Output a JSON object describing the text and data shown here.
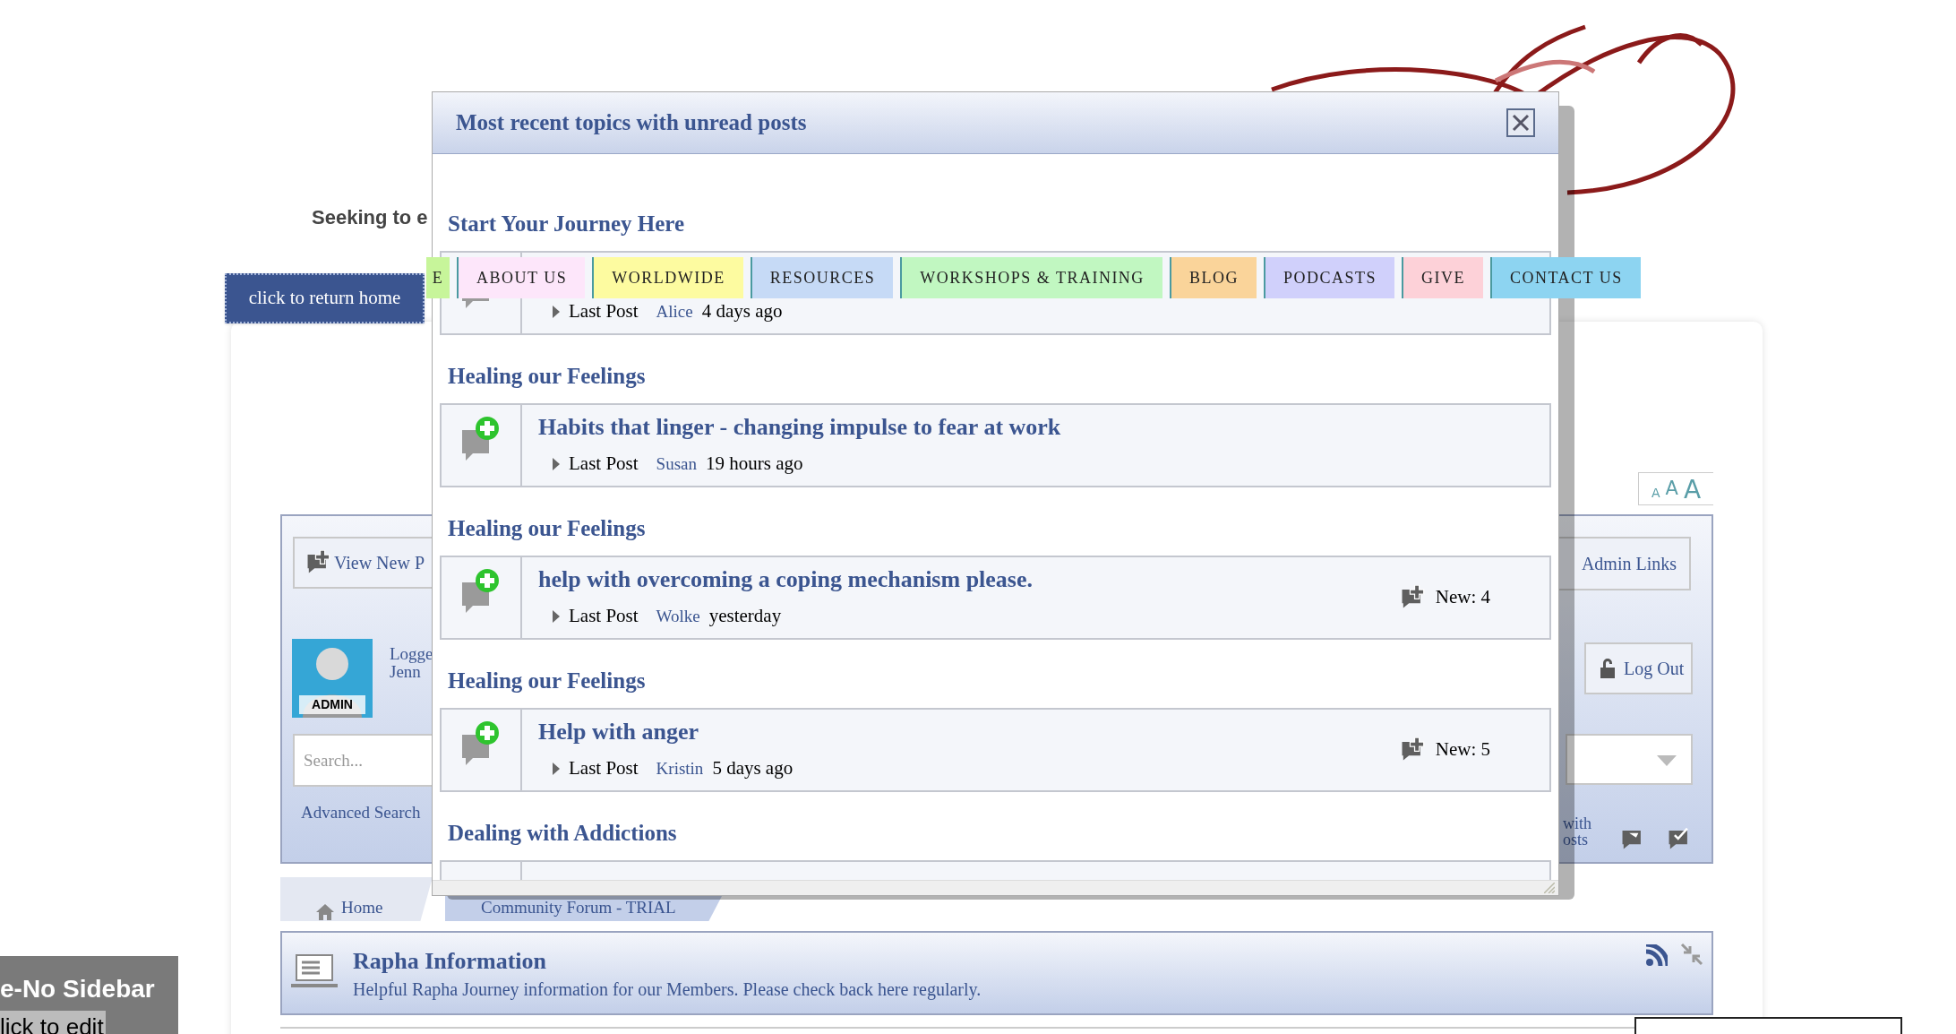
{
  "tagline_fragment": "Seeking to e",
  "return_home_button": "click to return home",
  "nav": [
    {
      "label": "E",
      "color": "#c7f59a"
    },
    {
      "label": "ABOUT US",
      "color": "#fde6fa"
    },
    {
      "label": "WORLDWIDE",
      "color": "#fdfba0"
    },
    {
      "label": "RESOURCES",
      "color": "#c6daf6"
    },
    {
      "label": "WORKSHOPS & TRAINING",
      "color": "#c1f7c1"
    },
    {
      "label": "BLOG",
      "color": "#fad49a"
    },
    {
      "label": "PODCASTS",
      "color": "#d0d0fb"
    },
    {
      "label": "GIVE",
      "color": "#fdd1d8"
    },
    {
      "label": "CONTACT US",
      "color": "#8dd4f1"
    }
  ],
  "font_size_control": [
    "A",
    "A",
    "A"
  ],
  "user_panel": {
    "view_new_posts": "View New P",
    "admin_links": "Admin Links",
    "logged_in": "Logge",
    "user": "Jenn",
    "avatar_badge": "ADMIN",
    "log_out": "Log Out",
    "search": {
      "placeholder": "Search..."
    },
    "advanced_search": "Advanced Search",
    "unread_fragment": "with\nosts"
  },
  "breadcrumbs": [
    {
      "label": "Home",
      "selected": false
    },
    {
      "label": "Community Forum - TRIAL",
      "selected": true
    }
  ],
  "board": {
    "title": "Rapha Information",
    "description": "Helpful Rapha Journey information for our Members. Please check back here regularly."
  },
  "edit_box": {
    "title": "e-No Sidebar",
    "link": "lick to edit"
  },
  "modal": {
    "title": "Most recent topics with unread posts",
    "sections": [
      {
        "heading": "Start Your Journey Here",
        "topic": {
          "last_post_label": "Last Post",
          "author": "Alice",
          "time": "4 days ago"
        }
      },
      {
        "heading": "Healing our Feelings",
        "topic": {
          "title": "Habits that linger - changing impulse to fear at work",
          "last_post_label": "Last Post",
          "author": "Susan",
          "time": "19 hours ago"
        }
      },
      {
        "heading": "Healing our Feelings",
        "topic": {
          "title": "help with overcoming a coping mechanism please.",
          "last_post_label": "Last Post",
          "author": "Wolke",
          "time": "yesterday",
          "new_count": "New: 4"
        }
      },
      {
        "heading": "Healing our Feelings",
        "topic": {
          "title": "Help with anger",
          "last_post_label": "Last Post",
          "author": "Kristin",
          "time": "5 days ago",
          "new_count": "New: 5"
        }
      },
      {
        "heading": "Dealing with Addictions"
      }
    ]
  }
}
